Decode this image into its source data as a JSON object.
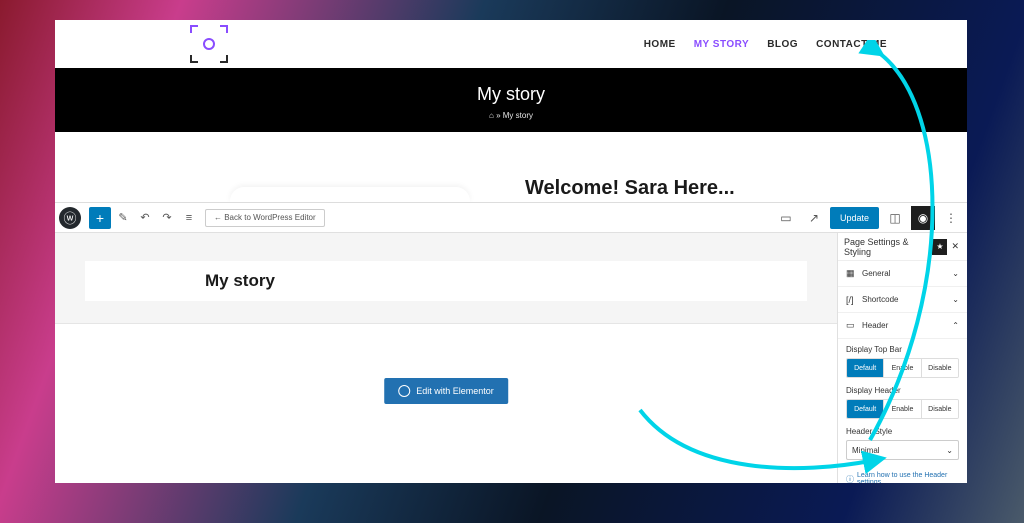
{
  "site": {
    "nav": {
      "home": "HOME",
      "mystory": "MY STORY",
      "blog": "BLOG",
      "contact": "CONTACT ME"
    },
    "hero": {
      "title": "My story",
      "crumb_sep": "»",
      "crumb_page": "My story"
    },
    "welcome": "Welcome! Sara Here..."
  },
  "toolbar": {
    "back": "← Back to WordPress Editor",
    "update": "Update"
  },
  "content": {
    "page_title": "My story",
    "elementor": "Edit with Elementor"
  },
  "sidebar": {
    "title": "Page Settings & Styling",
    "general": "General",
    "shortcode": "Shortcode",
    "header": "Header",
    "topbar": {
      "label": "Display Top Bar",
      "default": "Default",
      "enable": "Enable",
      "disable": "Disable"
    },
    "displayheader": {
      "label": "Display Header",
      "default": "Default",
      "enable": "Enable",
      "disable": "Disable"
    },
    "style": {
      "label": "Header Style",
      "value": "Minimal"
    },
    "link": "Learn how to use the Header settings."
  }
}
